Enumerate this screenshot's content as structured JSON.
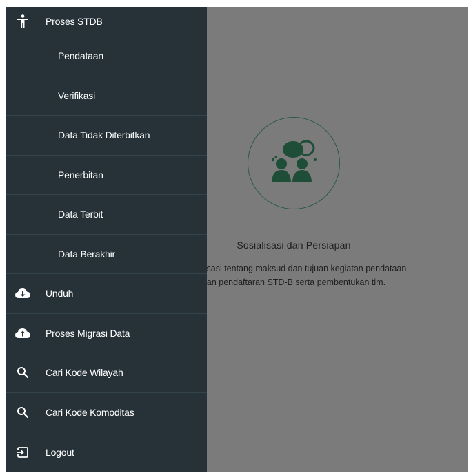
{
  "drawer": {
    "header": {
      "label": "Proses STDB",
      "icon": "accessibility-icon"
    },
    "sub_items": [
      {
        "label": "Pendataan"
      },
      {
        "label": "Verifikasi"
      },
      {
        "label": "Data Tidak Diterbitkan"
      },
      {
        "label": "Penerbitan"
      },
      {
        "label": "Data Terbit"
      },
      {
        "label": "Data Berakhir"
      }
    ],
    "items": [
      {
        "label": "Unduh",
        "icon": "cloud-download-icon"
      },
      {
        "label": "Proses Migrasi Data",
        "icon": "cloud-upload-icon"
      },
      {
        "label": "Cari Kode Wilayah",
        "icon": "search-icon"
      },
      {
        "label": "Cari Kode Komoditas",
        "icon": "search-icon"
      },
      {
        "label": "Logout",
        "icon": "logout-icon"
      }
    ]
  },
  "main": {
    "card_title": "Sosialisasi dan Persiapan",
    "card_desc_line1": "Sosialisasi tentang maksud dan tujuan kegiatan pendataan",
    "card_desc_line2": "dan pendaftaran STD-B serta pembentukan tim.",
    "icon": "discussion-icon"
  },
  "colors": {
    "drawer_bg": "#263238",
    "overlay_bg": "#7b7b7b",
    "accent_green": "#2a5a45"
  }
}
